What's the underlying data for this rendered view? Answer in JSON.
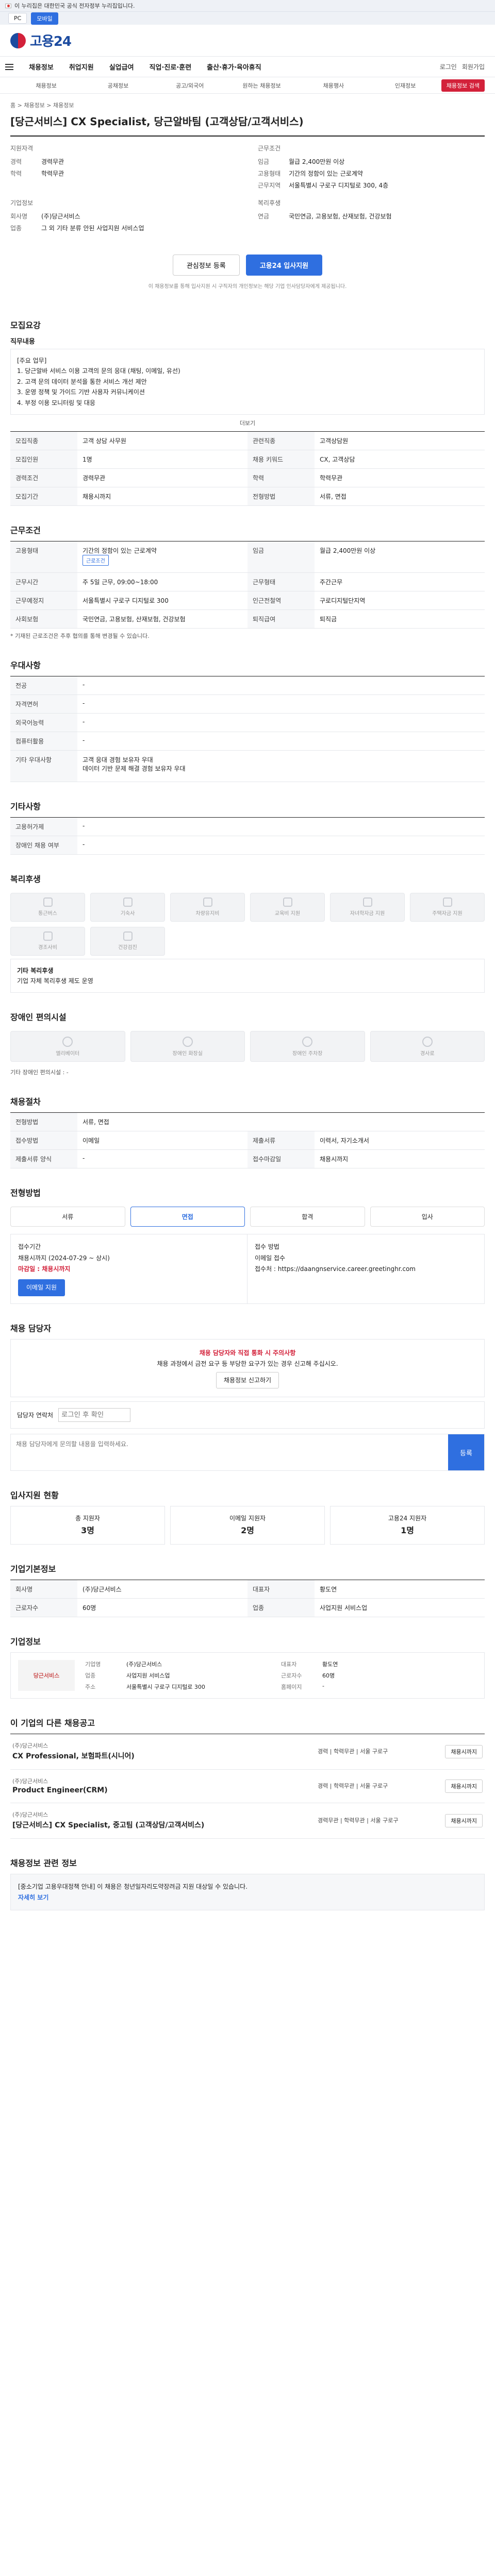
{
  "topbar": {
    "text": "이 누리집은 대한민국 공식 전자정부 누리집입니다."
  },
  "devices": [
    "PC",
    "모바일"
  ],
  "logo": "고용24",
  "gnb": {
    "items": [
      "채용정보",
      "취업지원",
      "실업급여",
      "직업·진로·훈련",
      "출산·휴가·육아휴직"
    ],
    "right": [
      "로그인",
      "회원가입"
    ]
  },
  "subnav": {
    "items": [
      "채용정보",
      "공채정보",
      "공고/외국어",
      "원하는 채용정보",
      "채용행사",
      "인재정보"
    ],
    "button": "채용정보 검색"
  },
  "crumb": "홈 > 채용정보 > 채용정보",
  "title": "[당근서비스] CX Specialist, 당근알바팀 (고객상담/고객서비스)",
  "summary": {
    "left_head": "지원자격",
    "left": [
      {
        "k": "경력",
        "v": "경력무관"
      },
      {
        "k": "학력",
        "v": "학력무관"
      }
    ],
    "right_head": "근무조건",
    "right": [
      {
        "k": "임금",
        "v": "월급 2,400만원 이상"
      },
      {
        "k": "고용형태",
        "v": "기간의 정함이 있는 근로계약"
      },
      {
        "k": "근무지역",
        "v": "서울특별시 구로구 디지털로 300, 4층"
      }
    ],
    "extra_left_head": "기업정보",
    "extra_left": [
      {
        "k": "회사명",
        "v": "(주)당근서비스"
      },
      {
        "k": "업종",
        "v": "그 외 기타 분류 안된 사업지원 서비스업"
      }
    ],
    "extra_right_head": "복리후생",
    "extra_right": [
      {
        "k": "연금",
        "v": "국민연금, 고용보험, 산재보험, 건강보험"
      }
    ]
  },
  "actions": {
    "scrap": "관심정보 등록",
    "apply": "고용24 입사지원"
  },
  "notice": "이 채용정보를 통해 입사지원 시 구직자의 개인정보는 해당 기업 인사담당자에게 제공됩니다.",
  "recruit": {
    "h": "모집요강",
    "duty_h": "직무내용",
    "duty": "[주요 업무]\n1. 당근알바 서비스 이용 고객의 문의 응대 (채팅, 이메일, 유선)\n2. 고객 문의 데이터 분석을 통한 서비스 개선 제안\n3. 운영 정책 및 가이드 기반 사용자 커뮤니케이션\n4. 부정 이용 모니터링 및 대응",
    "more": "더보기",
    "rows": [
      {
        "k": "모집직종",
        "v": "고객 상담 사무원",
        "k2": "관련직종",
        "v2": "고객상담원"
      },
      {
        "k": "모집인원",
        "v": "1명",
        "k2": "채용 키워드",
        "v2": "CX, 고객상담"
      },
      {
        "k": "경력조건",
        "v": "경력무관",
        "k2": "학력",
        "v2": "학력무관"
      },
      {
        "k": "모집기간",
        "v": "채용시까지",
        "k2": "전형방법",
        "v2": "서류, 면접"
      }
    ]
  },
  "work": {
    "h": "근무조건",
    "rows": [
      {
        "k": "고용형태",
        "v": "기간의 정함이 있는 근로계약",
        "k2": "임금",
        "v2": "월급 2,400만원 이상"
      },
      {
        "k": "근무시간",
        "v": "주 5일 근무, 09:00~18:00",
        "k2": "근무형태",
        "v2": "주간근무"
      },
      {
        "k": "근무예정지",
        "v": "서울특별시 구로구 디지털로 300",
        "k2": "인근전철역",
        "v2": "구로디지털단지역"
      },
      {
        "k": "사회보험",
        "v": "국민연금, 고용보험, 산재보험, 건강보험",
        "k2": "퇴직급여",
        "v2": "퇴직금"
      }
    ],
    "badge": "근로조건",
    "note": "* 기재된 근로조건은 추후 협의를 통해 변경될 수 있습니다."
  },
  "other": {
    "h": "우대사항",
    "rows": [
      {
        "k": "전공",
        "v": "-"
      },
      {
        "k": "자격면허",
        "v": "-"
      },
      {
        "k": "외국어능력",
        "v": "-"
      },
      {
        "k": "컴퓨터활용",
        "v": "-"
      },
      {
        "k": "기타 우대사항",
        "v": "고객 응대 경험 보유자 우대\n데이터 기반 문제 해결 경험 보유자 우대"
      }
    ]
  },
  "support": {
    "h": "기타사항",
    "rows": [
      {
        "k": "고용허가제",
        "v": "-"
      },
      {
        "k": "장애인 채용 여부",
        "v": "-"
      }
    ]
  },
  "welfare": {
    "h": "복리후생",
    "items": [
      "통근버스",
      "기숙사",
      "차량유지비",
      "교육비 지원",
      "자녀학자금 지원",
      "주택자금 지원",
      "경조사비",
      "건강검진"
    ],
    "note_h": "기타 복리후생",
    "note": "기업 자체 복리후생 제도 운영"
  },
  "facility": {
    "h": "장애인 편의시설",
    "items": [
      "엘리베이터",
      "장애인 화장실",
      "장애인 주차장",
      "경사로"
    ],
    "note": "기타 장애인 편의시설 : -"
  },
  "process": {
    "h": "채용절차",
    "rows": [
      {
        "k": "전형방법",
        "v": "서류, 면접"
      },
      {
        "k": "접수방법",
        "v": "이메일",
        "k2": "제출서류",
        "v2": "이력서, 자기소개서"
      },
      {
        "k": "제출서류 양식",
        "v": "-",
        "k2": "접수마감일",
        "v2": "채용시까지"
      }
    ]
  },
  "apply_steps": {
    "h": "전형방법",
    "steps": [
      "서류",
      "면접",
      "합격",
      "입사"
    ]
  },
  "apply_box": {
    "left": [
      "접수기간",
      "채용시까지 (2024-07-29 ~ 상시)"
    ],
    "deadline": "마감일 : 채용시까지",
    "right": [
      "접수 방법",
      "이메일 접수",
      "접수처 : https://daangnservice.career.greetinghr.com"
    ],
    "mail": "이메일 지원"
  },
  "manager": {
    "h": "채용 담당자",
    "alert_t": "채용 담당자와 직접 통화 시 주의사항",
    "alert": "채용 과정에서 금전 요구 등 부당한 요구가 있는 경우 신고해 주십시오.",
    "alert_btn": "채용정보 신고하기",
    "contact_label": "담당자 연락처",
    "contact_ph": "로그인 후 확인",
    "qa_ph": "채용 담당자에게 문의할 내용을 입력하세요.",
    "qa_btn": "등록"
  },
  "stats": {
    "h": "입사지원 현황",
    "cards": [
      {
        "t": "총 지원자",
        "v": "3명"
      },
      {
        "t": "이메일 지원자",
        "v": "2명"
      },
      {
        "t": "고용24 지원자",
        "v": "1명"
      }
    ]
  },
  "info": {
    "h": "기업기본정보",
    "rows": [
      {
        "k": "회사명",
        "v": "(주)당근서비스",
        "k2": "대표자",
        "v2": "황도연"
      },
      {
        "k": "근로자수",
        "v": "60명",
        "k2": "업종",
        "v2": "사업지원 서비스업"
      }
    ]
  },
  "company": {
    "h": "기업정보",
    "logo": "당근서비스",
    "info": [
      "기업명",
      "(주)당근서비스",
      "대표자",
      "황도연",
      "업종",
      "사업지원 서비스업",
      "근로자수",
      "60명",
      "주소",
      "서울특별시 구로구 디지털로 300",
      "홈페이지",
      "-"
    ]
  },
  "related": {
    "h": "이 기업의 다른 채용공고",
    "items": [
      {
        "co": "(주)당근서비스",
        "t": "CX Professional, 보험파트(시니어)",
        "m": "경력 | 학력무관 | 서울 구로구",
        "b": "채용시까지"
      },
      {
        "co": "(주)당근서비스",
        "t": "Product Engineer(CRM)",
        "m": "경력 | 학력무관 | 서울 구로구",
        "b": "채용시까지"
      },
      {
        "co": "(주)당근서비스",
        "t": "[당근서비스] CX Specialist, 중고팀 (고객상담/고객서비스)",
        "m": "경력무관 | 학력무관 | 서울 구로구",
        "b": "채용시까지"
      }
    ]
  },
  "footer": {
    "h": "채용정보 관련 정보",
    "text": "[중소기업 고용우대정책 안내] 이 채용은 청년일자리도약장려금 지원 대상일 수 있습니다.",
    "link": "자세히 보기"
  }
}
